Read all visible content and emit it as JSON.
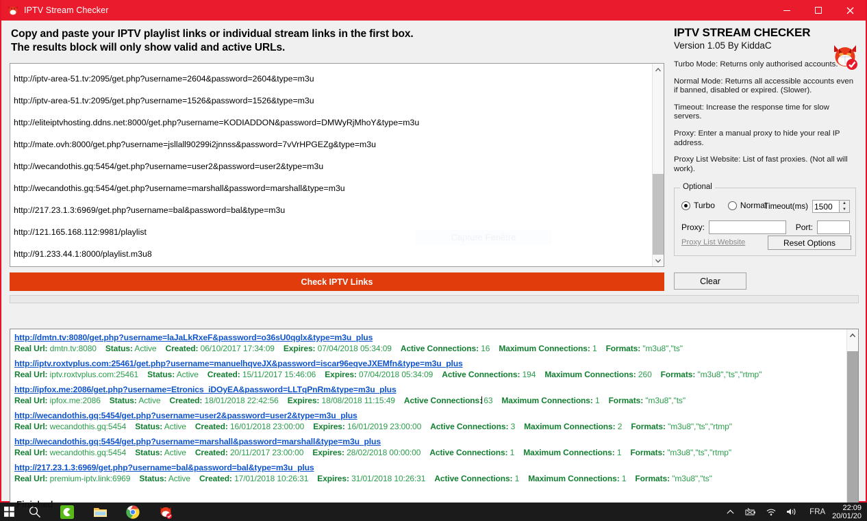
{
  "window": {
    "title": "IPTV Stream Checker",
    "icon": "devil-cat-icon",
    "titlebar_color": "#ea1b2d",
    "minimize_label": "Minimize",
    "maximize_label": "Maximize",
    "close_label": "Close"
  },
  "instructions": {
    "line1": "Copy and paste your IPTV playlist links or individual stream links in the first box.",
    "line2": "The results block will only show valid and active URLs."
  },
  "input_box": {
    "links": [
      "http://iptv-area-51.tv:2095/get.php?username=2604&password=2604&type=m3u",
      "http://iptv-area-51.tv:2095/get.php?username=1526&password=1526&type=m3u",
      "http://eliteiptvhosting.ddns.net:8000/get.php?username=KODIADDON&password=DMWyRjMhoY&type=m3u",
      "http://mate.ovh:8000/get.php?username=jsllall90299i2jnnss&password=7vVrHPGEZg&type=m3u",
      "http://wecandothis.gq:5454/get.php?username=user2&password=user2&type=m3u",
      "http://wecandothis.gq:5454/get.php?username=marshall&password=marshall&type=m3u",
      "http://217.23.1.3:6969/get.php?username=bal&password=bal&type=m3u",
      "http://121.165.168.112:9981/playlist",
      "http://91.233.44.1:8000/playlist.m3u8"
    ]
  },
  "buttons": {
    "check_label": "Check IPTV Links",
    "check_color": "#e03c0c",
    "clear_label": "Clear",
    "reset_label": "Reset Options"
  },
  "brand": {
    "title": "IPTV STREAM CHECKER",
    "version": "Version 1.05 By KiddaC",
    "logo": "devil-cat-check-icon"
  },
  "help": [
    "Turbo Mode:  Returns only authorised accounts.",
    "Normal Mode: Returns all accessible accounts even if banned, disabled or expired. (Slower).",
    "Timeout:  Increase the response time for slow servers.",
    "Proxy: Enter a manual proxy to hide your real IP address.",
    "Proxy List Website: List of fast proxies. (Not all will work)."
  ],
  "optional": {
    "legend": "Optional",
    "turbo_label": "Turbo",
    "turbo_selected": true,
    "normal_label": "Normal",
    "normal_selected": false,
    "timeout_label": "Timeout(ms)",
    "timeout_value": "1500",
    "proxy_label": "Proxy:",
    "proxy_value": "",
    "proxy_placeholder": "",
    "port_label": "Port:",
    "port_value": "",
    "port_placeholder": "",
    "proxy_list_link": "Proxy List Website"
  },
  "results": {
    "labels": {
      "real_url": "Real Url",
      "status": "Status",
      "created": "Created",
      "expires": "Expires",
      "active": "Active Connections",
      "maximum": "Maximum Connections",
      "formats": "Formats"
    },
    "rows": [
      {
        "url": "http://dmtn.tv:8080/get.php?username=laJaLkRxeF&password=o36sU0qglx&type=m3u_plus",
        "real_url": "dmtn.tv:8080",
        "status": "Active",
        "created": "06/10/2017 17:34:09",
        "expires": "07/04/2018 05:34:09",
        "active": "16",
        "maximum": "1",
        "formats": "\"m3u8\",\"ts\""
      },
      {
        "url": "http://iptv.roxtvplus.com:25461/get.php?username=manuelhqveJX&password=iscar96eqveJXEMfn&type=m3u_plus",
        "real_url": "iptv.roxtvplus.com:25461",
        "status": "Active",
        "created": "15/11/2017 15:46:06",
        "expires": "07/04/2018 05:34:09",
        "active": "194",
        "maximum": "260",
        "formats": "\"m3u8\",\"ts\",\"rtmp\""
      },
      {
        "url": "http://ipfox.me:2086/get.php?username=Etronics_iDOyEA&password=LLTqPnRm&type=m3u_plus",
        "real_url": "ipfox.me:2086",
        "status": "Active",
        "created": "18/01/2018 22:42:56",
        "expires": "18/08/2018 11:15:49",
        "active": "63",
        "maximum": "1",
        "formats": "\"m3u8\",\"ts\""
      },
      {
        "url": "http://wecandothis.gq:5454/get.php?username=user2&password=user2&type=m3u_plus",
        "real_url": "wecandothis.gq:5454",
        "status": "Active",
        "created": "16/01/2018 23:00:00",
        "expires": "16/01/2019 23:00:00",
        "active": "3",
        "maximum": "2",
        "formats": "\"m3u8\",\"ts\",\"rtmp\""
      },
      {
        "url": "http://wecandothis.gq:5454/get.php?username=marshall&password=marshall&type=m3u_plus",
        "real_url": "wecandothis.gq:5454",
        "status": "Active",
        "created": "20/11/2017 23:00:00",
        "expires": "28/02/2018 00:00:00",
        "active": "1",
        "maximum": "1",
        "formats": "\"m3u8\",\"ts\",\"rtmp\""
      },
      {
        "url": "http://217.23.1.3:6969/get.php?username=bal&password=bal&type=m3u_plus",
        "real_url": "premium-iptv.link:6969",
        "status": "Active",
        "created": "17/01/2018 10:26:31",
        "expires": "31/01/2018 10:26:31",
        "active": "1",
        "maximum": "1",
        "formats": "\"m3u8\",\"ts\""
      }
    ]
  },
  "status": {
    "text": "Finished"
  },
  "watermark": {
    "text": "Capture Fenêtre"
  },
  "taskbar": {
    "start_label": "start-icon",
    "search_label": "search-icon",
    "apps": [
      "camtasia-icon",
      "file-explorer-icon",
      "chrome-icon",
      "iptv-checker-icon"
    ],
    "tray": [
      "chevron-up-icon",
      "battery-icon",
      "wifi-icon",
      "volume-icon"
    ],
    "language": "FRA",
    "time": "22:09",
    "date": "20/01/20"
  }
}
